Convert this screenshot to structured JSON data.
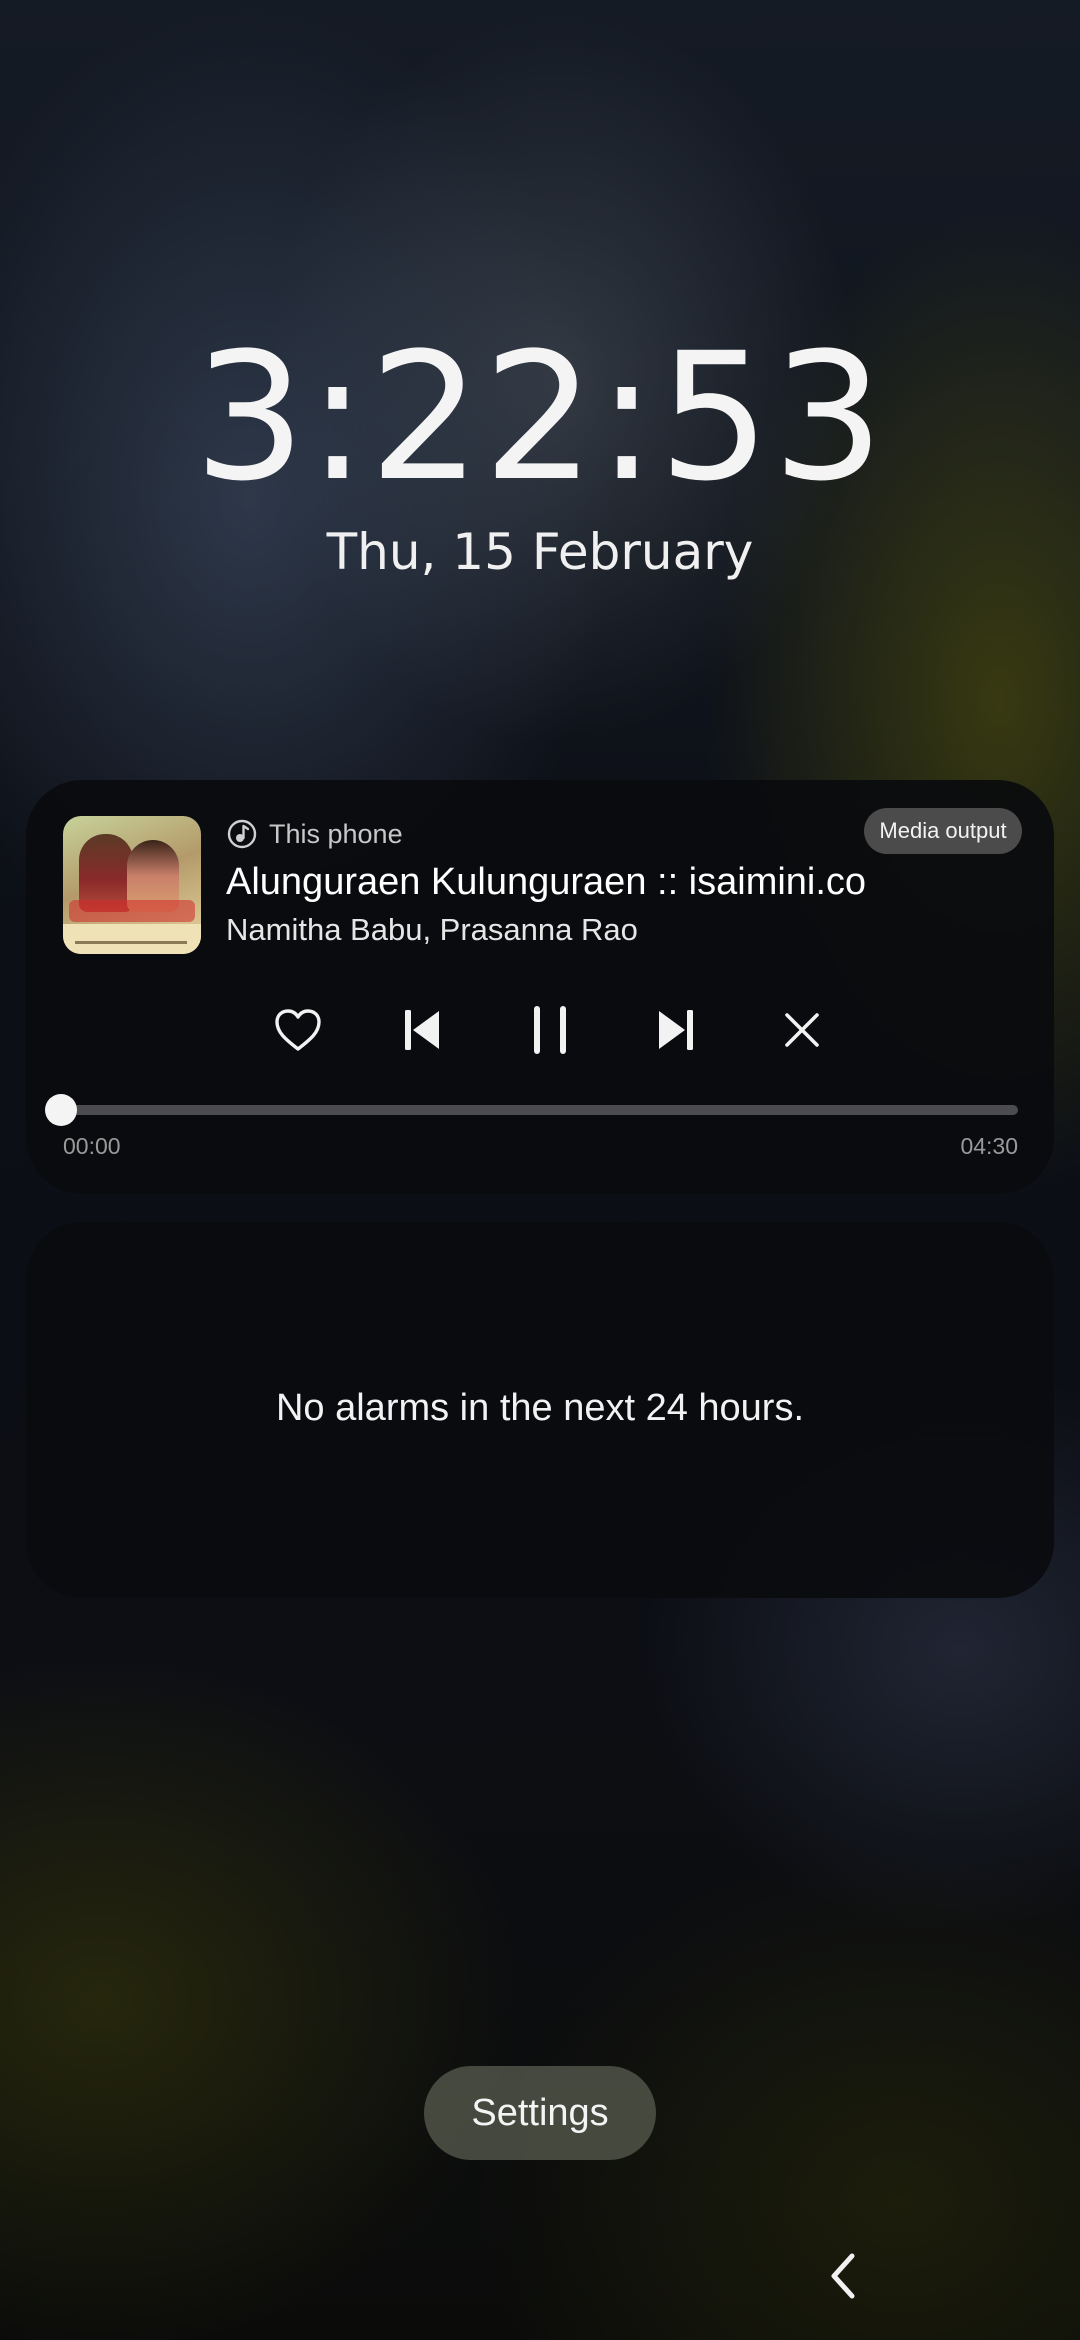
{
  "lockscreen": {
    "time": "3:22:53",
    "date": "Thu, 15 February"
  },
  "media": {
    "source_label": "This phone",
    "source_icon": "music-note-icon",
    "output_button": "Media output",
    "title": "Alunguraen Kulunguraen :: isaimini.co",
    "artist": "Namitha Babu, Prasanna Rao",
    "controls": [
      "heart-icon",
      "skip-previous-icon",
      "pause-icon",
      "skip-next-icon",
      "close-icon"
    ],
    "elapsed": "00:00",
    "duration": "04:30",
    "progress": 0.0
  },
  "alarm": {
    "message": "No alarms in the next 24 hours."
  },
  "footer": {
    "settings_label": "Settings",
    "nav_icon": "back-chevron-icon"
  }
}
